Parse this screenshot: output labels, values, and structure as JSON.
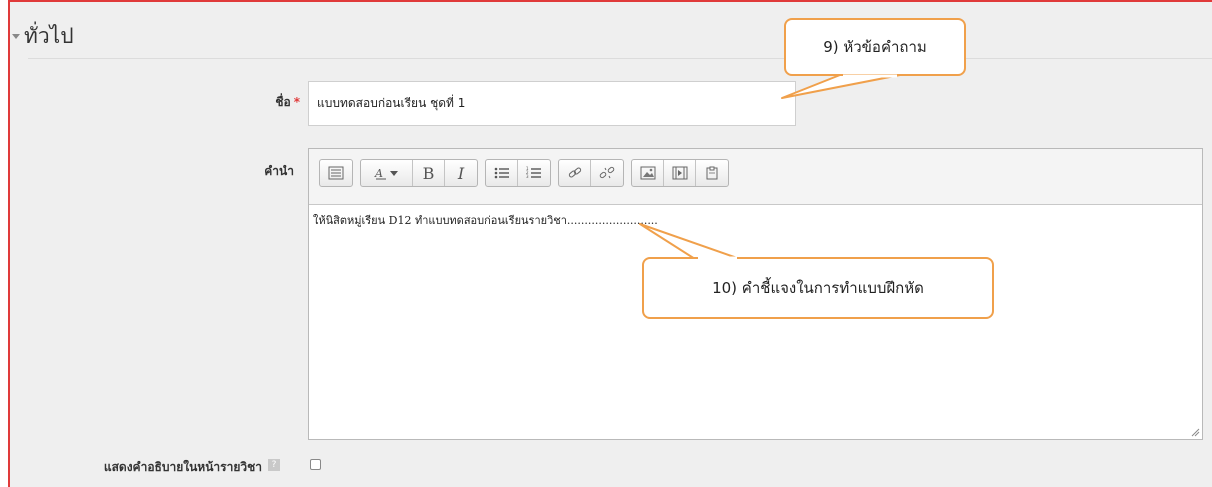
{
  "section": {
    "title": "ทั่วไป"
  },
  "name_field": {
    "label": "ชื่อ",
    "required_marker": "*",
    "value": "แบบทดสอบก่อนเรียน ชุดที่ 1"
  },
  "description_field": {
    "label": "คำนำ",
    "content": "ให้นิสิตหมู่เรียน D12 ทำแบบทดสอบก่อนเรียนรายวิชา.........................."
  },
  "toolbar": {
    "buttons": [
      "toolbar-toggle-icon",
      "font-color-icon",
      "bold-icon",
      "italic-icon",
      "unordered-list-icon",
      "ordered-list-icon",
      "link-icon",
      "unlink-icon",
      "image-icon",
      "media-icon",
      "manage-files-icon"
    ],
    "bold_glyph": "B",
    "italic_glyph": "I"
  },
  "show_description": {
    "label": "แสดงคำอธิบายในหน้ารายวิชา",
    "help_glyph": "?",
    "checked": false
  },
  "callouts": {
    "title_note": "9) หัวข้อคำถาม",
    "instruction_note": "10) คำชี้แจงในการทำแบบฝึกหัด"
  },
  "colors": {
    "accent_border": "#e03a3a",
    "callout_border": "#f0a04b",
    "background": "#efefef"
  }
}
